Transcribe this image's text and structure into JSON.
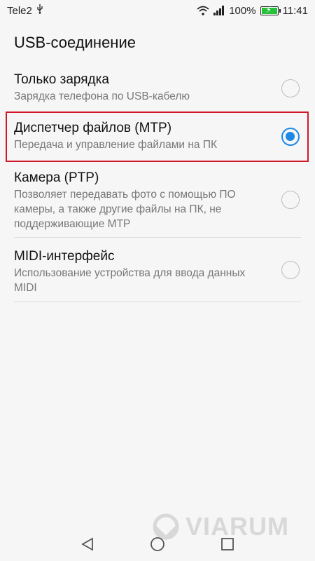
{
  "status_bar": {
    "carrier": "Tele2",
    "battery_percent": "100%",
    "time": "11:41",
    "icons": [
      "usb-icon",
      "wifi-icon",
      "signal-icon",
      "battery-charging-icon"
    ]
  },
  "title": "USB-соединение",
  "options": [
    {
      "title": "Только зарядка",
      "subtitle": "Зарядка телефона по USB-кабелю",
      "selected": false
    },
    {
      "title": "Диспетчер файлов (MTP)",
      "subtitle": "Передача и управление файлами на ПК",
      "selected": true
    },
    {
      "title": "Камера (PTP)",
      "subtitle": "Позволяет передавать фото с помощью ПО камеры, а также другие файлы на ПК, не поддерживающие MTP",
      "selected": false
    },
    {
      "title": "MIDI-интерфейс",
      "subtitle": "Использование устройства для ввода данных MIDI",
      "selected": false
    }
  ],
  "watermark": "VIARUM",
  "nav": [
    "back-icon",
    "home-icon",
    "recents-icon"
  ],
  "colors": {
    "accent": "#1e88e5",
    "highlight": "#d0182b",
    "battery": "#27c23a"
  }
}
